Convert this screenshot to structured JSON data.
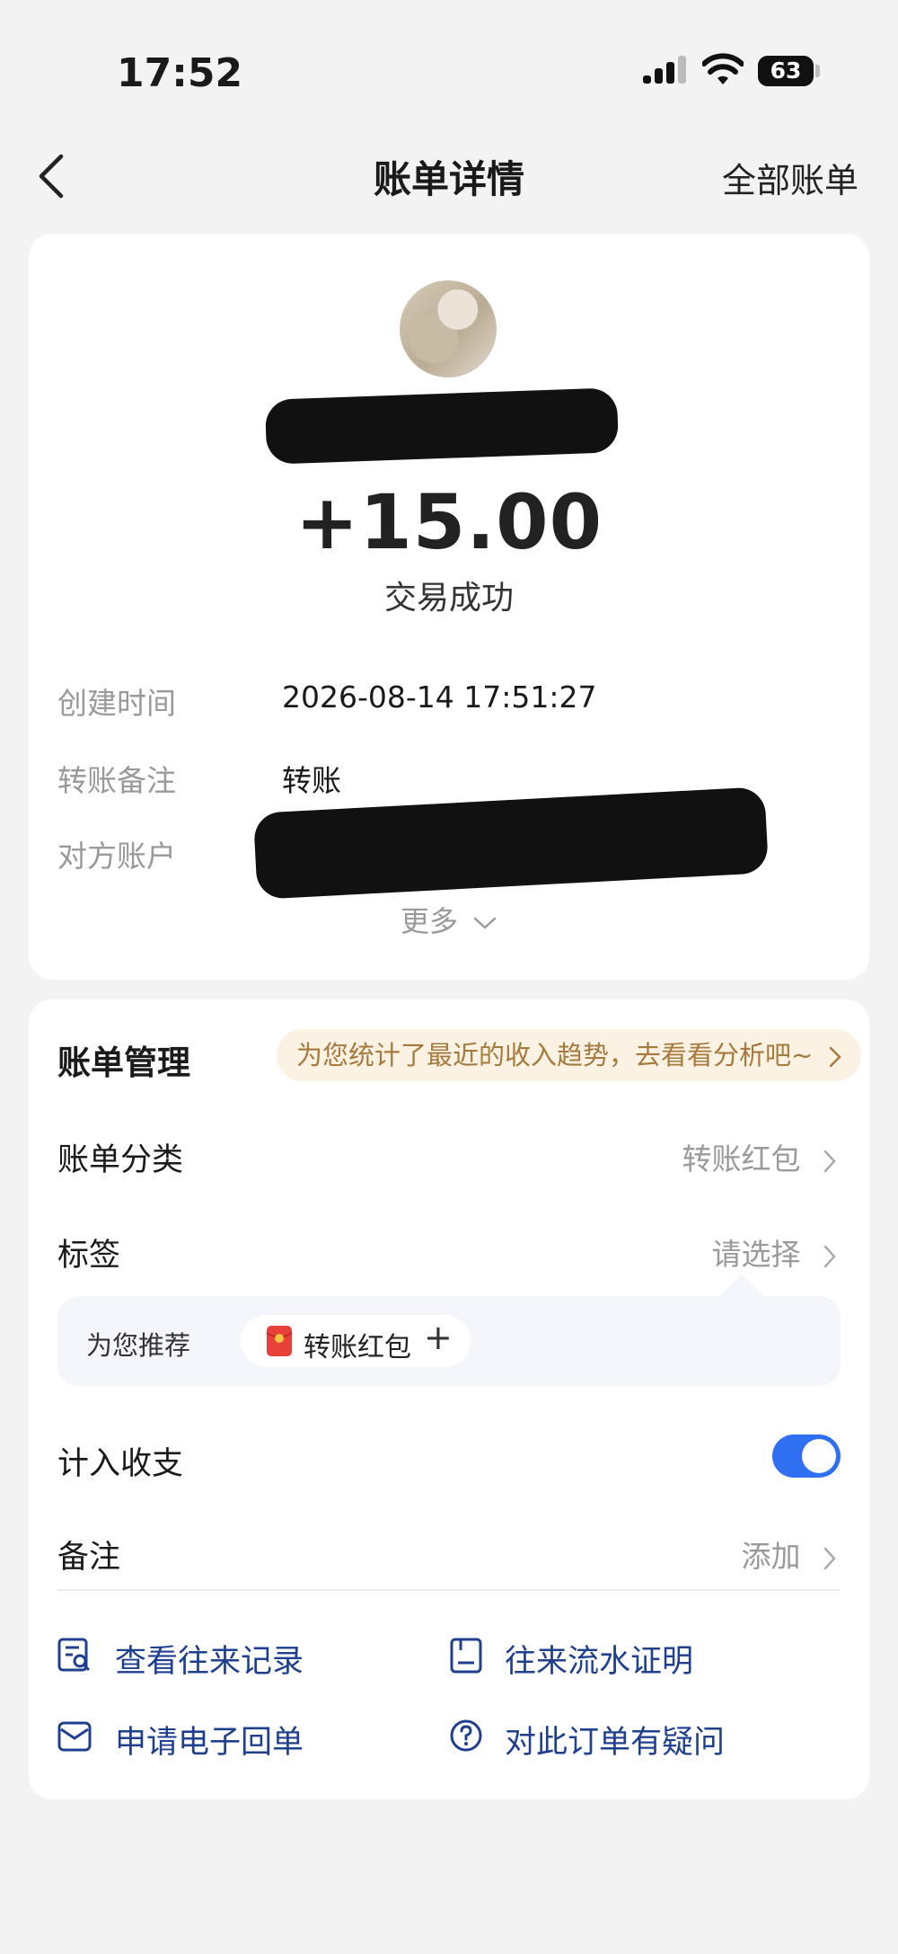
{
  "status_bar": {
    "time": "17:52",
    "battery": "63",
    "battery_level": 0.63
  },
  "nav": {
    "title": "账单详情",
    "right_link": "全部账单"
  },
  "transaction": {
    "amount": "+15.00",
    "status": "交易成功",
    "details": [
      {
        "label": "创建时间",
        "value": "2026-08-14 17:51:27"
      },
      {
        "label": "转账备注",
        "value": "转账"
      },
      {
        "label": "对方账户",
        "value": ""
      }
    ],
    "more": "更多"
  },
  "management": {
    "title": "账单管理",
    "tip": "为您统计了最近的收入趋势，去看看分析吧~",
    "category": {
      "label": "账单分类",
      "value": "转账红包"
    },
    "tags": {
      "label": "标签",
      "value": "请选择"
    },
    "recommend": {
      "label": "为您推荐",
      "chip": "转账红包",
      "plus": "+"
    },
    "include": {
      "label": "计入收支",
      "enabled": true
    },
    "note": {
      "label": "备注",
      "value": "添加"
    },
    "links": [
      {
        "label": "查看往来记录",
        "icon": "records-search-icon"
      },
      {
        "label": "往来流水证明",
        "icon": "document-icon"
      },
      {
        "label": "申请电子回单",
        "icon": "envelope-icon"
      },
      {
        "label": "对此订单有疑问",
        "icon": "question-icon"
      }
    ]
  },
  "colors": {
    "accent": "#2f6ff2",
    "link": "#1f3f8f",
    "tip_text": "#a57a3c",
    "tip_bg": "#fbf2e3"
  }
}
